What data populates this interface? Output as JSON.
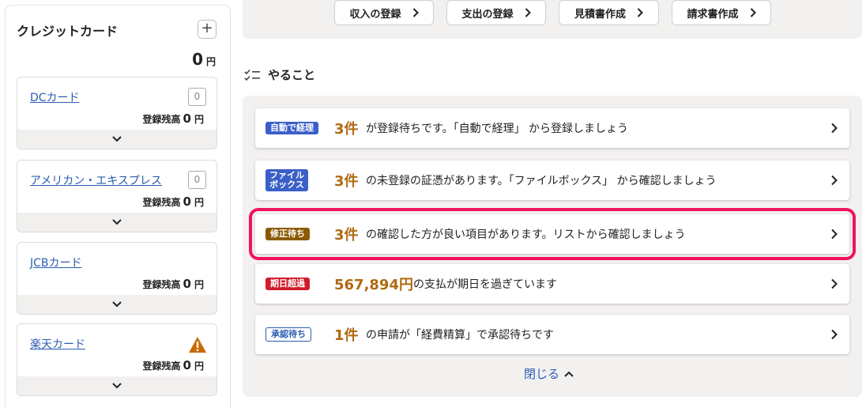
{
  "sidebar": {
    "title": "クレジットカード",
    "plus": "+",
    "total_amount": "0",
    "currency": "円",
    "cards": [
      {
        "name": "DCカード",
        "count": "0",
        "balance_label": "登録残高",
        "balance": "0",
        "currency": "円",
        "status": "count"
      },
      {
        "name": "アメリカン・エキスプレス",
        "count": "0",
        "balance_label": "登録残高",
        "balance": "0",
        "currency": "円",
        "status": "count"
      },
      {
        "name": "JCBカード",
        "count": "",
        "balance_label": "登録残高",
        "balance": "0",
        "currency": "円",
        "status": "none"
      },
      {
        "name": "楽天カード",
        "count": "",
        "balance_label": "登録残高",
        "balance": "0",
        "currency": "円",
        "status": "warning"
      }
    ]
  },
  "toolbar": {
    "buttons": [
      {
        "label": "収入の登録"
      },
      {
        "label": "支出の登録"
      },
      {
        "label": "見積書作成"
      },
      {
        "label": "請求書作成"
      }
    ]
  },
  "todo": {
    "title": "やること",
    "close_label": "閉じる",
    "tasks": [
      {
        "badge": "自動で経理",
        "badge_color": "#3a5fc8",
        "count": "3件",
        "text": "が登録待ちです。「自動で経理」 から登録しましょう"
      },
      {
        "badge_line1": "ファイル",
        "badge_line2": "ボックス",
        "badge_color": "#3a5fc8",
        "count": "3件",
        "text": "の未登録の証憑があります。「ファイルボックス」 から確認しましょう"
      },
      {
        "badge": "修正待ち",
        "badge_color": "#8a5a00",
        "count": "3件",
        "text": "の確認した方が良い項目があります。リストから確認しましょう"
      },
      {
        "badge": "期日超過",
        "badge_color": "#d01c2c",
        "count": "567,894円",
        "text": "の支払が期日を過ぎています"
      },
      {
        "badge": "承認待ち",
        "badge_color": "#2a5db0",
        "count": "1件",
        "text": "の申請が「経費精算」で承認待ちです"
      }
    ]
  },
  "colors": {
    "accent_blue": "#2a5db0",
    "count_orange": "#b06a12",
    "highlight_pink": "#f0135f",
    "warning_orange": "#c96a00"
  }
}
